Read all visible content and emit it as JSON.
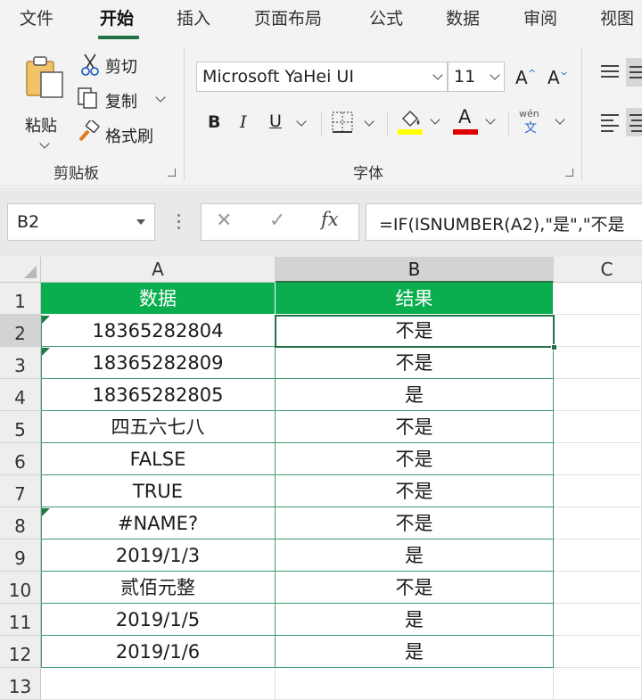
{
  "tabs": [
    {
      "label": "文件",
      "active": false
    },
    {
      "label": "开始",
      "active": true
    },
    {
      "label": "插入",
      "active": false
    },
    {
      "label": "页面布局",
      "active": false
    },
    {
      "label": "公式",
      "active": false
    },
    {
      "label": "数据",
      "active": false
    },
    {
      "label": "审阅",
      "active": false
    },
    {
      "label": "视图",
      "active": false
    }
  ],
  "clipboard": {
    "paste_label": "粘贴",
    "cut_label": "剪切",
    "copy_label": "复制",
    "format_painter_label": "格式刷",
    "group_label": "剪贴板"
  },
  "font": {
    "font_name": "Microsoft YaHei UI",
    "font_size": "11",
    "bold_label": "B",
    "italic_label": "I",
    "underline_label": "U",
    "grow_label": "A",
    "shrink_label": "A",
    "font_color_label": "A",
    "phonetic_top": "wén",
    "phonetic_bottom": "文",
    "group_label": "字体",
    "fill_color": "#ffff00",
    "font_color": "#e00000"
  },
  "formula_bar": {
    "name_box": "B2",
    "fx_label": "fx",
    "formula": "=IF(ISNUMBER(A2),\"是\",\"不是"
  },
  "columns": [
    "A",
    "B",
    "C"
  ],
  "rows": [
    "1",
    "2",
    "3",
    "4",
    "5",
    "6",
    "7",
    "8",
    "9",
    "10",
    "11",
    "12",
    "13"
  ],
  "table": {
    "headers": [
      "数据",
      "结果"
    ],
    "data": [
      [
        "18365282804",
        "不是"
      ],
      [
        "18365282809",
        "不是"
      ],
      [
        "18365282805",
        "是"
      ],
      [
        "四五六七八",
        "不是"
      ],
      [
        "FALSE",
        "不是"
      ],
      [
        "TRUE",
        "不是"
      ],
      [
        "#NAME?",
        "不是"
      ],
      [
        "2019/1/3",
        "是"
      ],
      [
        "贰佰元整",
        "不是"
      ],
      [
        "2019/1/5",
        "是"
      ],
      [
        "2019/1/6",
        "是"
      ]
    ]
  },
  "colors": {
    "accent": "#217346",
    "header_fill": "#0aae4f"
  }
}
